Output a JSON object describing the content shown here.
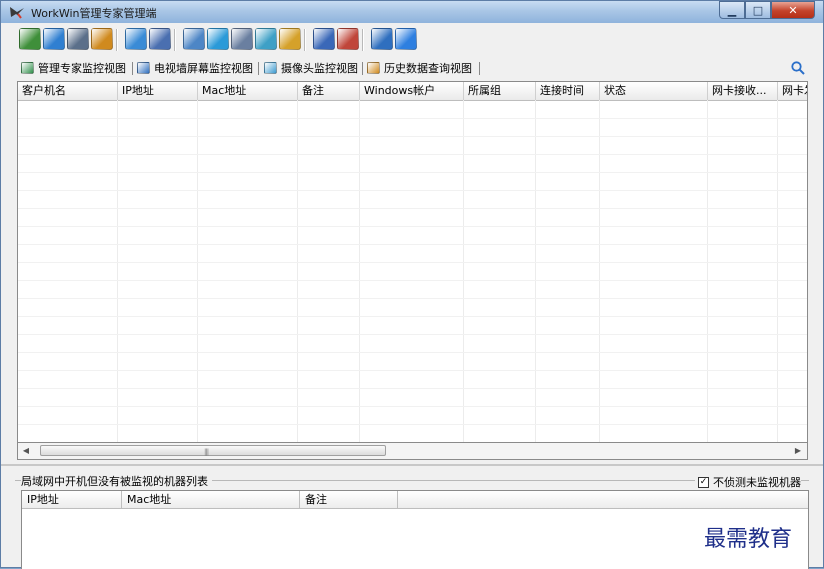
{
  "window": {
    "title": "WorkWin管理专家管理端",
    "buttons": {
      "minimize": "▁",
      "maximize": "□",
      "close": "✕"
    }
  },
  "toolbar": {
    "buttons": [
      {
        "icon": "stack-icon",
        "color": "#3f8f3a"
      },
      {
        "icon": "globe-icon",
        "color": "#2f7fd1"
      },
      {
        "icon": "monitor-settings-icon",
        "color": "#5b6f8a"
      },
      {
        "icon": "users-icon",
        "color": "#d08a1e"
      },
      {
        "icon": "pencil-icon",
        "color": "#3a8bd6"
      },
      {
        "icon": "pushpin-icon",
        "color": "#4a6fb0"
      },
      {
        "icon": "screen-icon",
        "color": "#4d86c6"
      },
      {
        "icon": "tools-icon",
        "color": "#2b9ad8"
      },
      {
        "icon": "report-icon",
        "color": "#6a7fa0"
      },
      {
        "icon": "copy-icon",
        "color": "#3ea0c6"
      },
      {
        "icon": "disk-icon",
        "color": "#d5a12a"
      },
      {
        "icon": "save-icon",
        "color": "#3a68b8"
      },
      {
        "icon": "document-icon",
        "color": "#c0463a"
      },
      {
        "icon": "cart-icon",
        "color": "#2f6fbf"
      },
      {
        "icon": "help-icon",
        "color": "#2e7fe0"
      }
    ]
  },
  "tabs": [
    {
      "label": "管理专家监控视图",
      "icon": "monitor-view-icon",
      "color": "#2f8f4a"
    },
    {
      "label": "电视墙屏幕监控视图",
      "icon": "tv-wall-icon",
      "color": "#2f6fbf"
    },
    {
      "label": "摄像头监控视图",
      "icon": "camera-icon",
      "color": "#3b9ad0"
    },
    {
      "label": "历史数据查询视图",
      "icon": "history-icon",
      "color": "#d08a1e"
    }
  ],
  "main_table": {
    "columns": [
      "客户机名",
      "IP地址",
      "Mac地址",
      "备注",
      "Windows帐户",
      "所属组",
      "连接时间",
      "状态",
      "网卡接收...",
      "网卡发"
    ],
    "rows": []
  },
  "scrollbar": {
    "left_arrow": "◀",
    "right_arrow": "▶",
    "grip": "|||"
  },
  "bottom_panel": {
    "title": "局域网中开机但没有被监视的机器列表",
    "checkbox_label": "不侦测未监视机器",
    "checkbox_checked": true,
    "checkbox_mark": "✓",
    "columns": [
      "IP地址",
      "Mac地址",
      "备注"
    ]
  },
  "watermark": "最需教育"
}
